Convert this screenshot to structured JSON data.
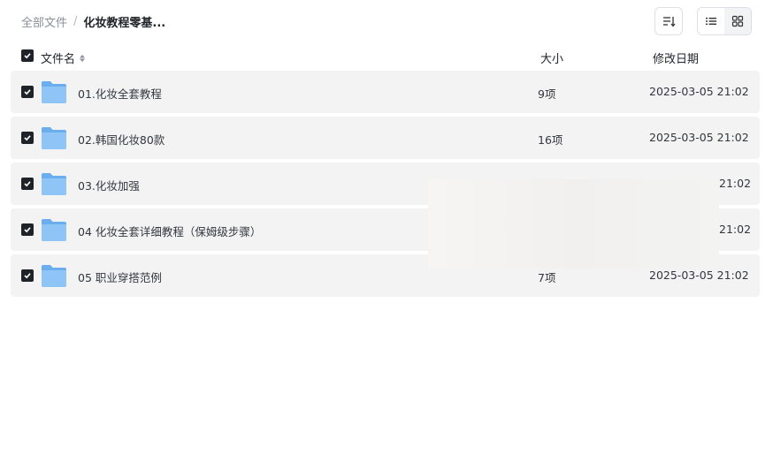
{
  "breadcrumb": {
    "root": "全部文件",
    "separator": "/",
    "current": "化妆教程零基..."
  },
  "toolbar": {
    "sort_icon": "sort-lines-icon",
    "list_view_icon": "list-view-icon",
    "grid_view_icon": "grid-view-icon"
  },
  "table": {
    "headers": {
      "name": "文件名",
      "size": "大小",
      "modified": "修改日期"
    },
    "rows": [
      {
        "name": "01.化妆全套教程",
        "size": "9项",
        "modified": "2025-03-05 21:02"
      },
      {
        "name": "02.韩国化妆80款",
        "size": "16项",
        "modified": "2025-03-05 21:02"
      },
      {
        "name": "03.化妆加强",
        "size": "",
        "modified": "21:02"
      },
      {
        "name": "04 化妆全套详细教程（保姆级步骤）",
        "size": "",
        "modified": "21:02"
      },
      {
        "name": "05 职业穿搭范例",
        "size": "7项",
        "modified": "2025-03-05 21:02"
      }
    ]
  },
  "colors": {
    "folder": "#7cb6f3",
    "row_bg": "#f3f3f3",
    "checkbox": "#1f2329"
  }
}
